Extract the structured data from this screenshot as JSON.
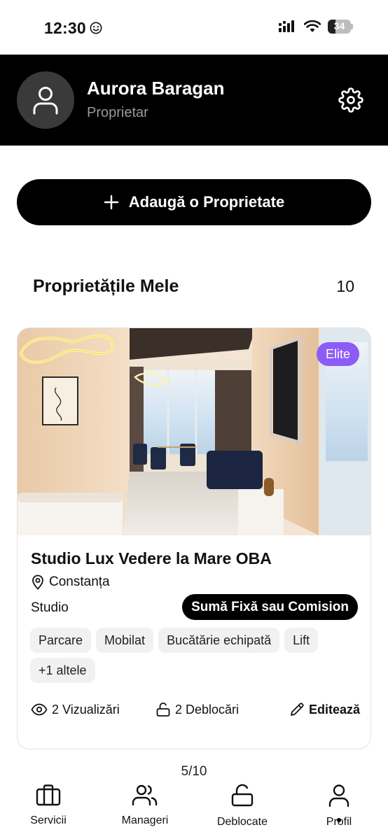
{
  "status_bar": {
    "time": "12:30",
    "battery": "34",
    "battery_level": 0.34
  },
  "profile": {
    "name": "Aurora Baragan",
    "role": "Proprietar"
  },
  "add_button": {
    "label": "Adaugă o Proprietate"
  },
  "section": {
    "title": "Proprietățile Mele",
    "count": "10"
  },
  "property": {
    "badge": "Elite",
    "title": "Studio Lux Vedere la Mare OBA",
    "location": "Constanța",
    "type": "Studio",
    "pricing": "Sumă Fixă sau Comision",
    "amenities": [
      "Parcare",
      "Mobilat",
      "Bucătărie echipată",
      "Lift",
      "+1 altele"
    ],
    "views": "2 Vizualizări",
    "unlocks": "2 Deblocări",
    "edit": "Editează"
  },
  "pager": "5/10",
  "nav": {
    "items": [
      {
        "label": "Servicii",
        "icon": "briefcase-icon"
      },
      {
        "label": "Manageri",
        "icon": "users-icon"
      },
      {
        "label": "Deblocate",
        "icon": "unlock-icon"
      },
      {
        "label": "Profil",
        "icon": "user-icon",
        "active": true
      }
    ]
  }
}
